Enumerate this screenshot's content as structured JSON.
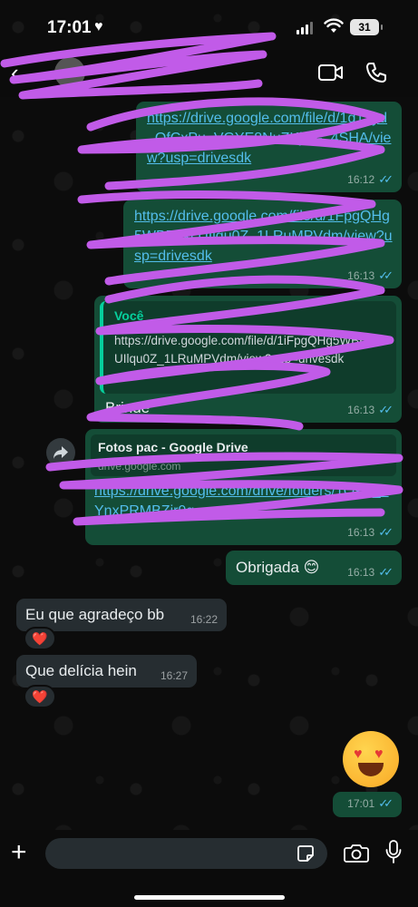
{
  "status_bar": {
    "time": "17:01",
    "battery": "31"
  },
  "header": {
    "contact_name": ""
  },
  "messages": [
    {
      "link": "https://drive.google.com/file/d/1g12yd_QfCxPu_VGYE8NuZKjJq-_4SHA/view?usp=drivesdk",
      "time": "16:12"
    },
    {
      "link": "https://drive.google.com/file/d/1FpgQHg5WBBftkcUIlqu0Z_1LRuMPVdm/view?usp=drivesdk",
      "time": "16:13"
    },
    {
      "quote_author": "Você",
      "quote_text": "https://drive.google.com/file/d/1iFpgQHg5WBBftkcUIlqu0Z_1LRuMPVdm/view?usp=drivesdk",
      "text": "Brinde",
      "time": "16:13"
    },
    {
      "preview_title": "Fotos pac  - Google Drive",
      "preview_domain": "drive.google.com",
      "link": "https://drive.google.com/drive/folders/1OsR_4YnxPRMBZir9q",
      "time": "16:13"
    },
    {
      "text": "Obrigada 😊",
      "time": "16:13"
    },
    {
      "text": "Eu que agradeço bb",
      "time": "16:22",
      "reaction": "❤️"
    },
    {
      "text": "Que delícia hein",
      "time": "16:27",
      "reaction": "❤️"
    },
    {
      "emoji": "😍",
      "time": "17:01"
    }
  ],
  "input": {
    "placeholder": ""
  },
  "colors": {
    "outgoing": "#144d37",
    "incoming": "#262d31",
    "link": "#53bdeb",
    "scribble": "#c15be8"
  }
}
